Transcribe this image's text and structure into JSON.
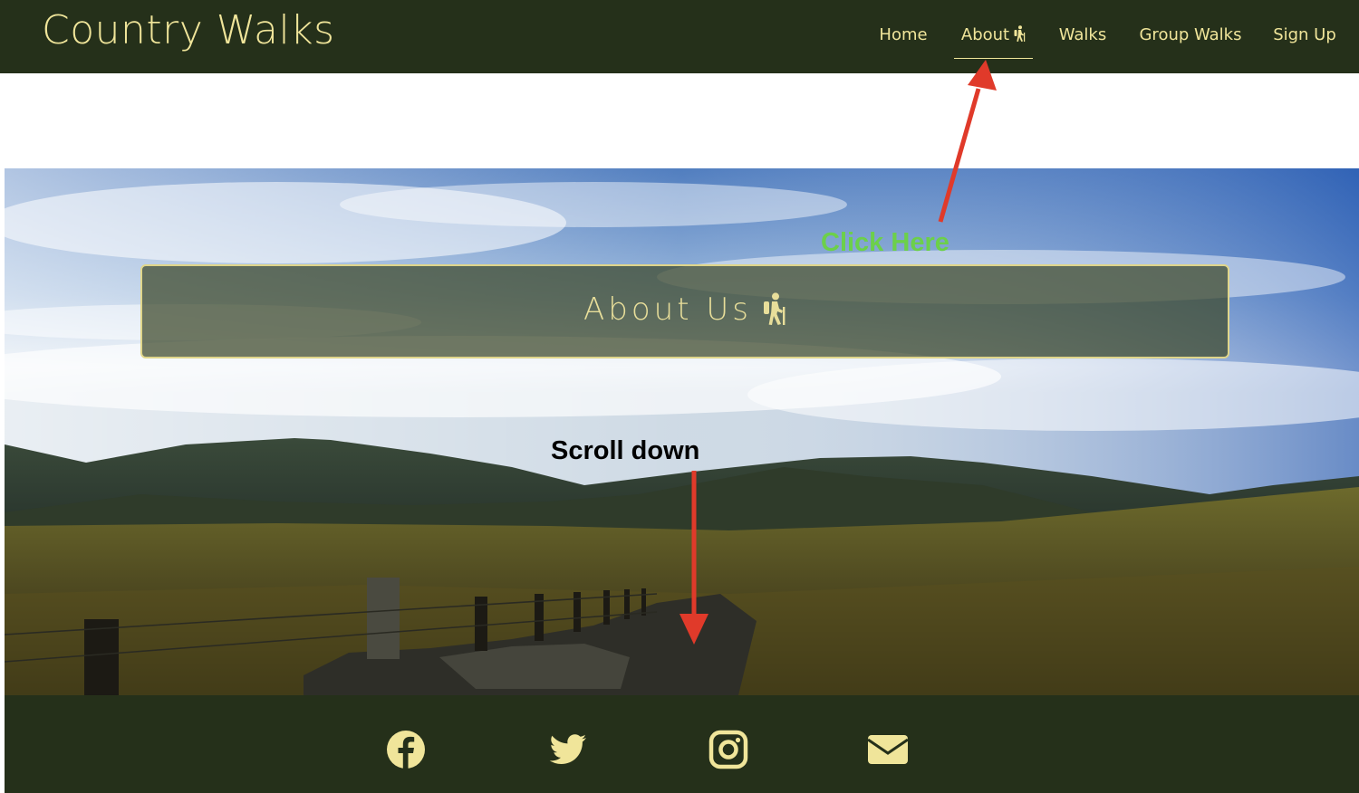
{
  "header": {
    "brand": "Country Walks",
    "nav": [
      {
        "label": "Home"
      },
      {
        "label": "About",
        "icon": "hiking-icon",
        "active": true
      },
      {
        "label": "Walks"
      },
      {
        "label": "Group Walks"
      },
      {
        "label": "Sign Up"
      }
    ]
  },
  "hero": {
    "title": "About Us",
    "title_icon": "hiking-icon",
    "background": "mountain-landscape-photo"
  },
  "annotations": {
    "click": "Click Here",
    "scroll": "Scroll down",
    "arrow_color": "#e03a2a",
    "click_color": "#6cd04a"
  },
  "footer": {
    "social": [
      "facebook-icon",
      "twitter-icon",
      "instagram-icon",
      "envelope-icon"
    ]
  },
  "colors": {
    "nav_bg": "#25301a",
    "accent": "#f0e59a"
  }
}
